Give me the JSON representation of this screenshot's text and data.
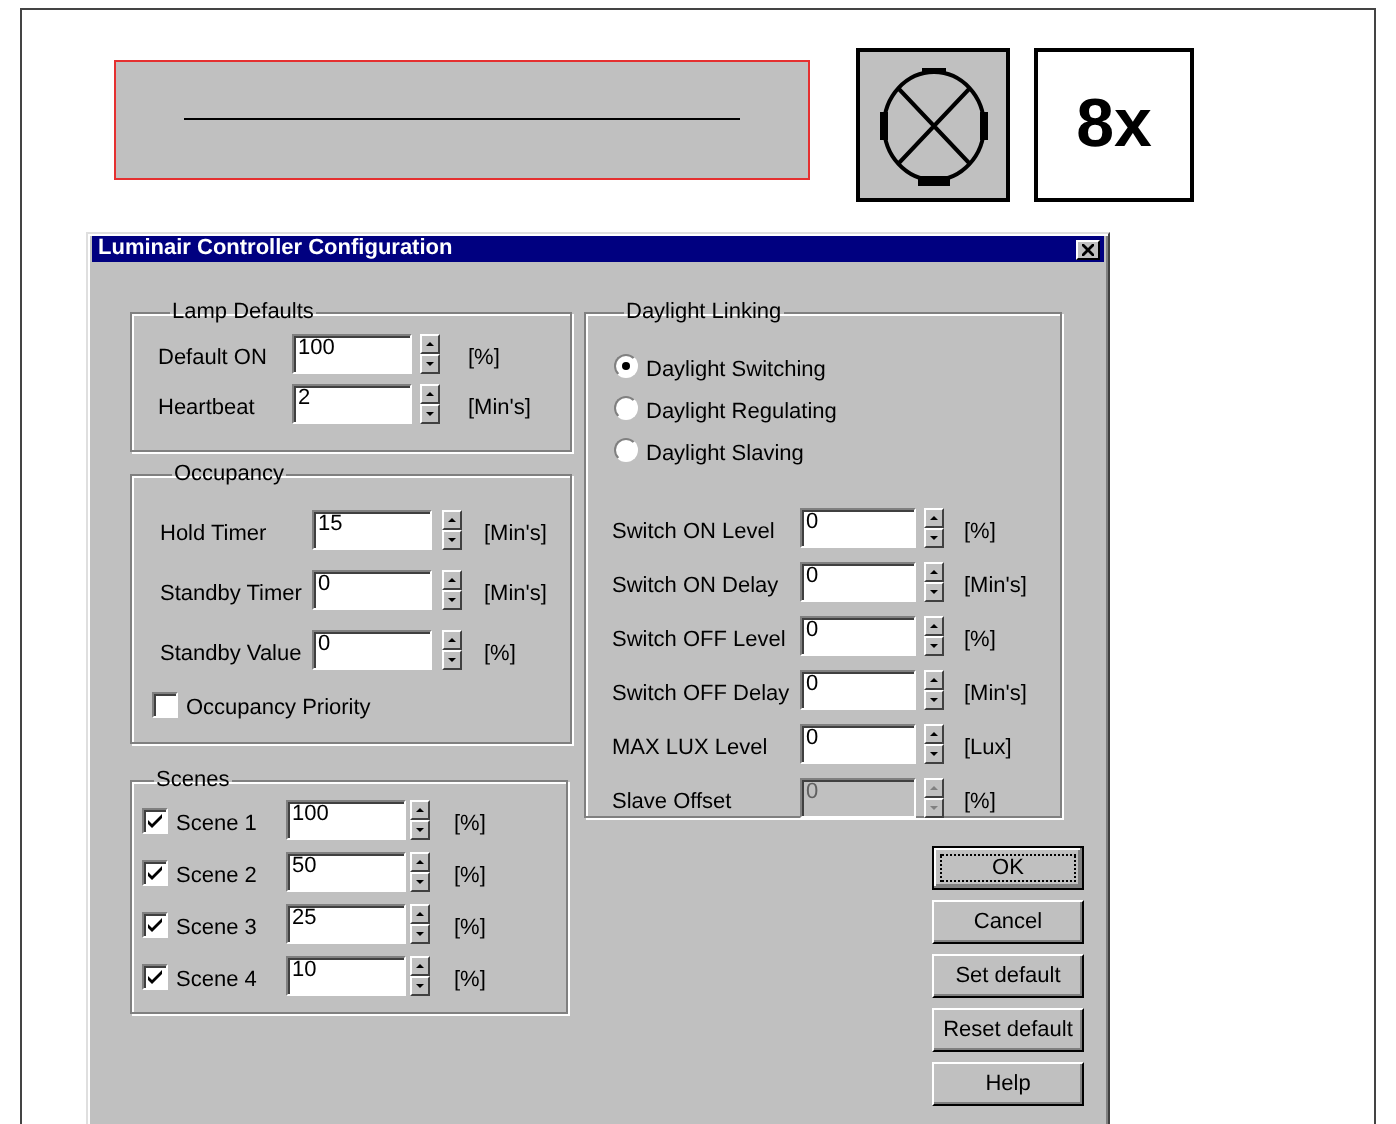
{
  "zoom_label": "8x",
  "dialog": {
    "title": "Luminair Controller Configuration",
    "lamp_defaults": {
      "title": "Lamp Defaults",
      "fields": [
        {
          "label": "Default ON",
          "value": "100",
          "unit": "[%]"
        },
        {
          "label": "Heartbeat",
          "value": "2",
          "unit": "[Min's]"
        }
      ]
    },
    "occupancy": {
      "title": "Occupancy",
      "fields": [
        {
          "label": "Hold Timer",
          "value": "15",
          "unit": "[Min's]"
        },
        {
          "label": "Standby Timer",
          "value": "0",
          "unit": "[Min's]"
        },
        {
          "label": "Standby Value",
          "value": "0",
          "unit": "[%]"
        }
      ],
      "priority": {
        "label": "Occupancy Priority",
        "checked": false
      }
    },
    "scenes": {
      "title": "Scenes",
      "items": [
        {
          "label": "Scene 1",
          "checked": true,
          "value": "100",
          "unit": "[%]"
        },
        {
          "label": "Scene 2",
          "checked": true,
          "value": "50",
          "unit": "[%]"
        },
        {
          "label": "Scene 3",
          "checked": true,
          "value": "25",
          "unit": "[%]"
        },
        {
          "label": "Scene 4",
          "checked": true,
          "value": "10",
          "unit": "[%]"
        }
      ]
    },
    "daylight": {
      "title": "Daylight Linking",
      "modes": [
        {
          "label": "Daylight Switching",
          "selected": true
        },
        {
          "label": "Daylight Regulating",
          "selected": false
        },
        {
          "label": "Daylight Slaving",
          "selected": false
        }
      ],
      "fields": [
        {
          "label": "Switch ON Level",
          "value": "0",
          "unit": "[%]",
          "disabled": false
        },
        {
          "label": "Switch ON Delay",
          "value": "0",
          "unit": "[Min's]",
          "disabled": false
        },
        {
          "label": "Switch OFF Level",
          "value": "0",
          "unit": "[%]",
          "disabled": false
        },
        {
          "label": "Switch OFF Delay",
          "value": "0",
          "unit": "[Min's]",
          "disabled": false
        },
        {
          "label": "MAX LUX Level",
          "value": "0",
          "unit": "[Lux]",
          "disabled": false
        },
        {
          "label": "Slave Offset",
          "value": "0",
          "unit": "[%]",
          "disabled": true
        }
      ]
    },
    "buttons": [
      {
        "label": "OK",
        "default": true
      },
      {
        "label": "Cancel",
        "default": false
      },
      {
        "label": "Set default",
        "default": false
      },
      {
        "label": "Reset default",
        "default": false
      },
      {
        "label": "Help",
        "default": false
      }
    ]
  }
}
